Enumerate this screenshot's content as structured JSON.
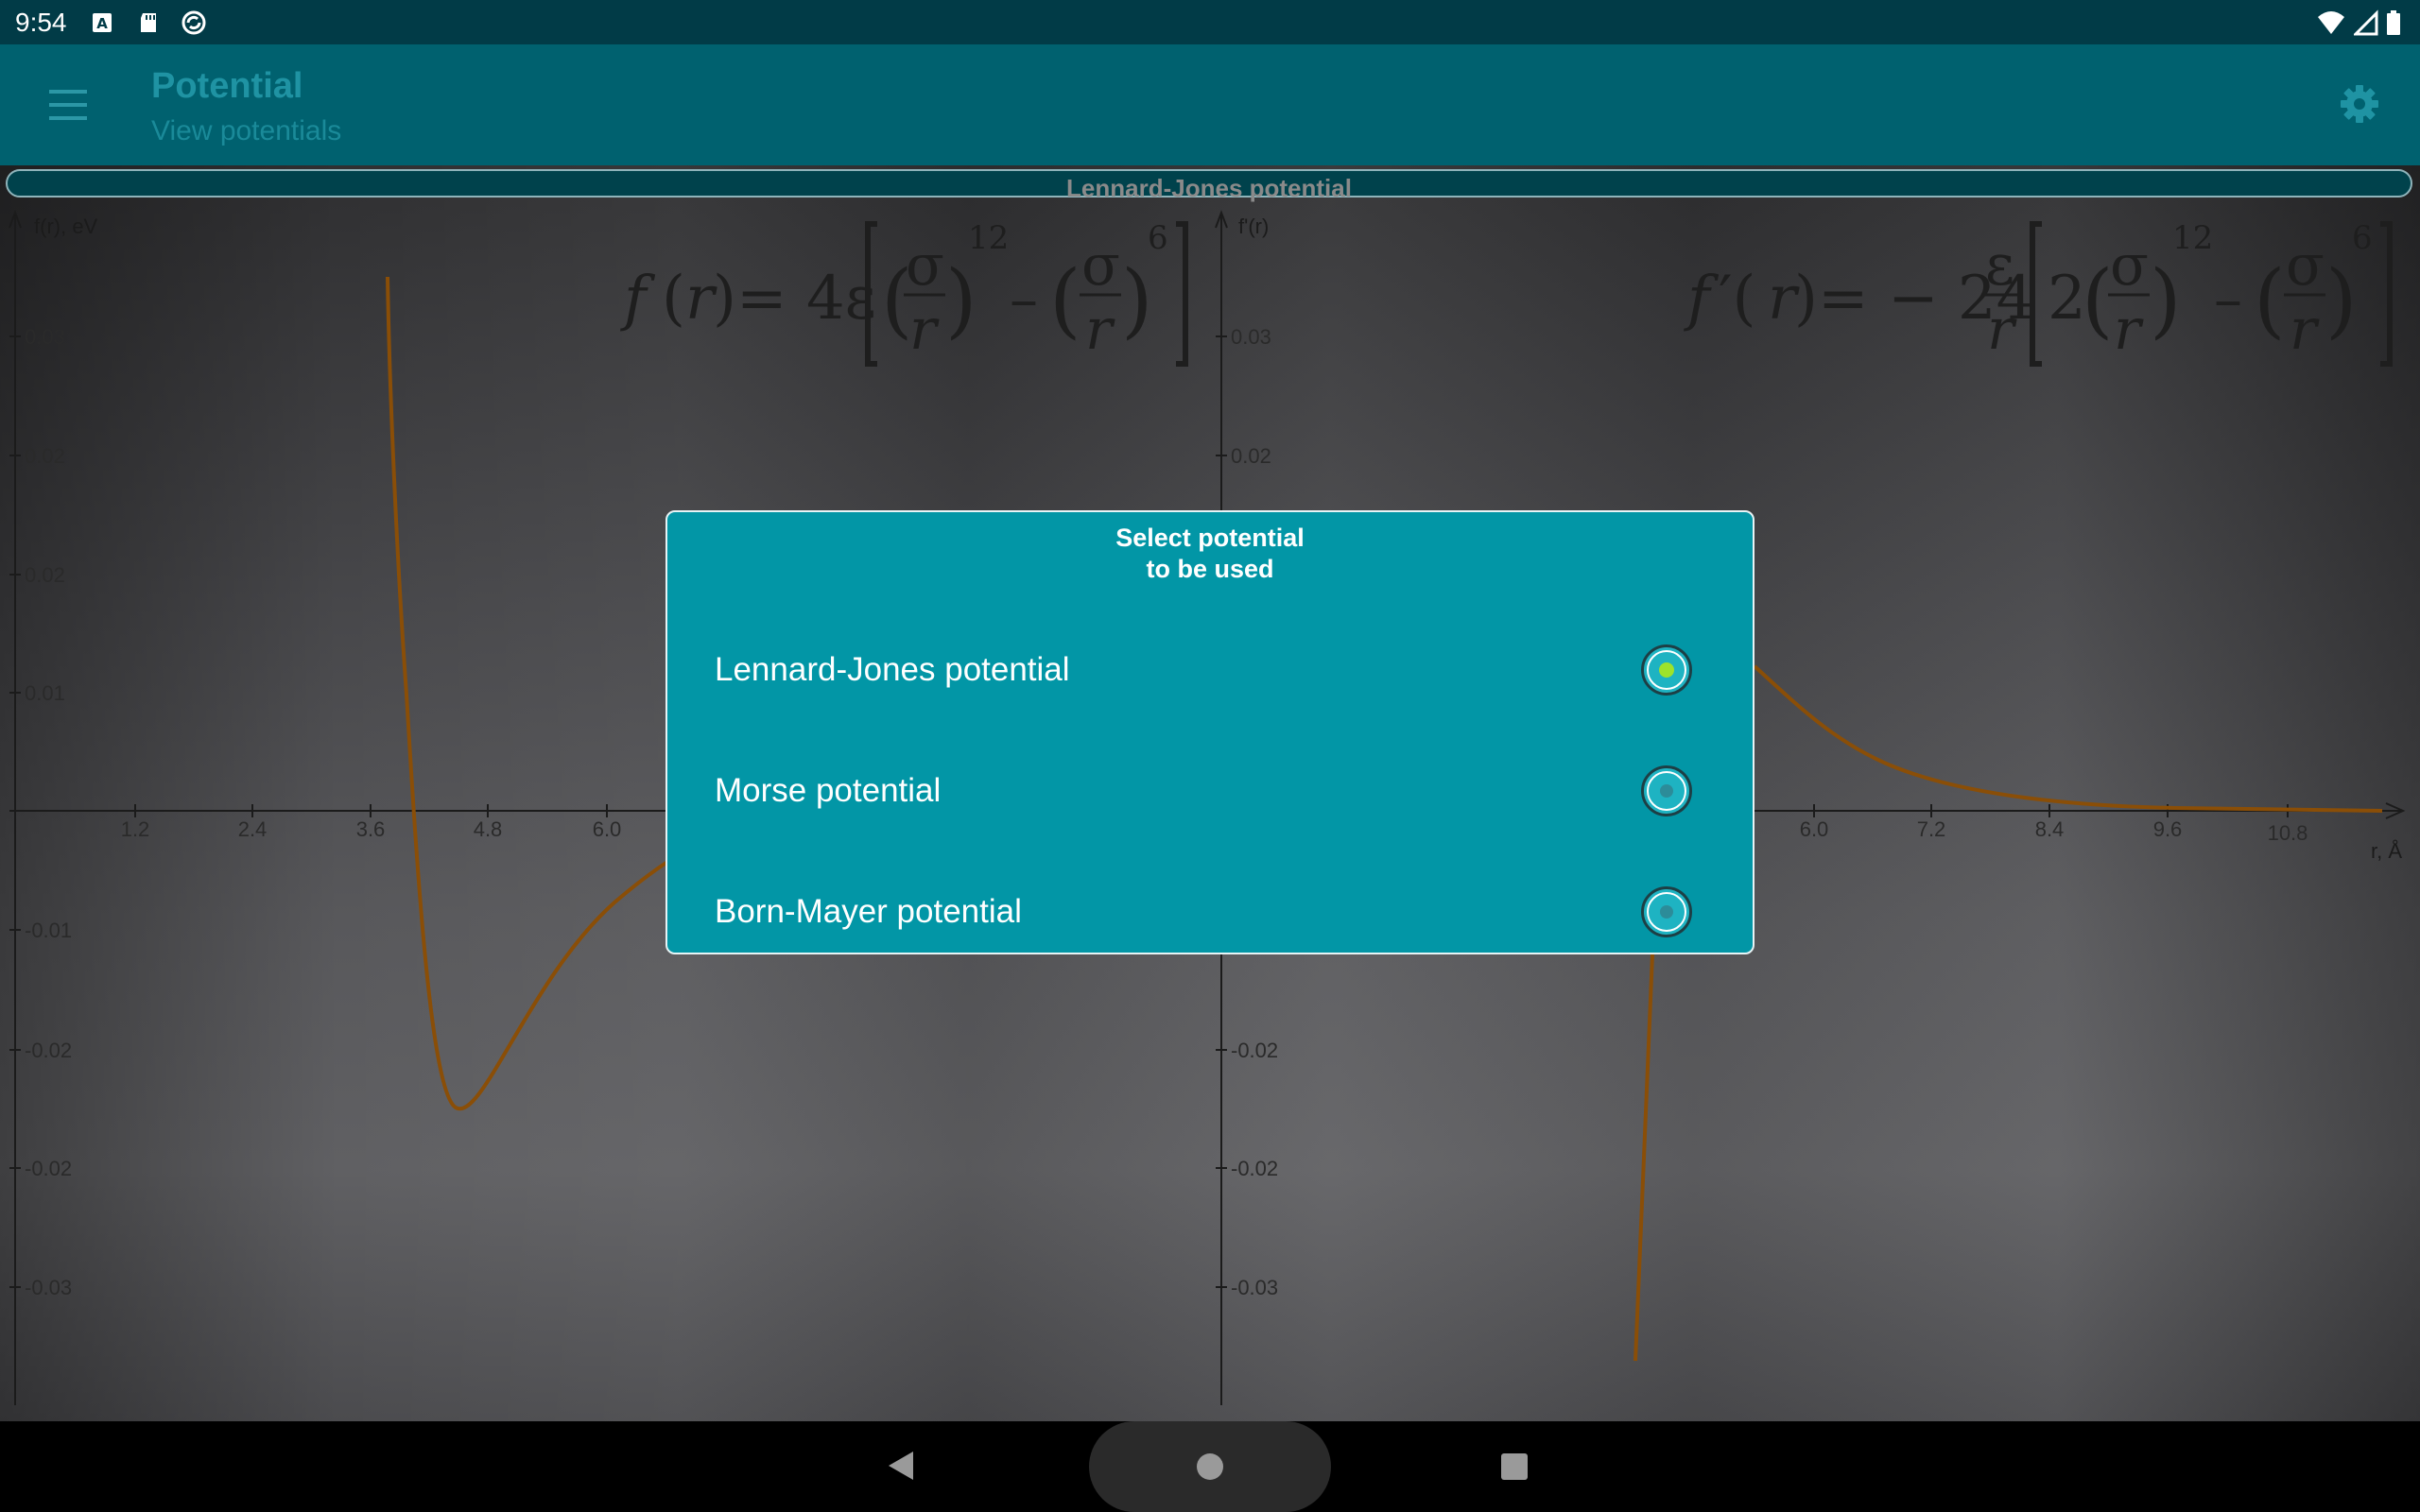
{
  "status_bar": {
    "time": "9:54"
  },
  "app_bar": {
    "title": "Potential",
    "subtitle": "View potentials"
  },
  "banner": {
    "label": "Lennard-Jones potential"
  },
  "left_plot": {
    "y_label": "f(r), eV",
    "y_ticks": [
      "0.03",
      "0.02",
      "0.02",
      "0.01",
      "-0.01",
      "-0.02",
      "-0.02",
      "-0.03"
    ],
    "x_ticks": [
      "1.2",
      "2.4",
      "3.6",
      "4.8",
      "6.0"
    ],
    "formula": "f(r)= 4ε[(σ/r)^12 − (σ/r)^6]"
  },
  "right_plot": {
    "y_label": "f'(r)",
    "y_ticks": [
      "0.03",
      "0.02",
      "-0.02",
      "-0.02",
      "-0.03"
    ],
    "x_ticks": [
      "6.0",
      "7.2",
      "8.4",
      "9.6",
      "10.8"
    ],
    "x_label": "r, Å",
    "formula": "f'(r)= − 24 ε/r [2(σ/r)^12 − (σ/r)^6]"
  },
  "dialog": {
    "title_line1": "Select potential",
    "title_line2": "to be used",
    "options": [
      {
        "label": "Lennard-Jones potential",
        "selected": true
      },
      {
        "label": "Morse potential",
        "selected": false
      },
      {
        "label": "Born-Mayer potential",
        "selected": false
      }
    ]
  },
  "colors": {
    "curve": "#8a4e07",
    "app_bar": "#00616f",
    "dialog": "#0296a6",
    "radio_checked": "#9de32b"
  },
  "icons": [
    "menu-icon",
    "settings-gear-icon",
    "wifi-icon",
    "signal-icon",
    "battery-icon",
    "nav-back-icon",
    "nav-home-icon",
    "nav-recents-icon"
  ]
}
